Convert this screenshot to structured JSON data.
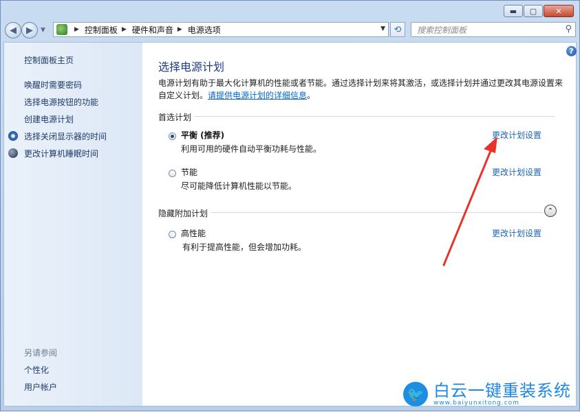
{
  "window": {
    "minimize_glyph": "▬",
    "maximize_glyph": "▢",
    "close_glyph": "✕"
  },
  "nav": {
    "back_icon": "◀",
    "forward_icon": "▶",
    "recent_icon": "▼",
    "breadcrumbs": [
      "控制面板",
      "硬件和声音",
      "电源选项"
    ],
    "crumb_separator": "▶",
    "refresh_glyph": "⟲",
    "search_placeholder": "搜索控制面板",
    "search_glyph": "⚲"
  },
  "sidebar": {
    "home": "控制面板主页",
    "items": [
      {
        "label": "唤醒时需要密码",
        "icon": null
      },
      {
        "label": "选择电源按钮的功能",
        "icon": null
      },
      {
        "label": "创建电源计划",
        "icon": null
      },
      {
        "label": "选择关闭显示器的时间",
        "icon": "clock-icon"
      },
      {
        "label": "更改计算机睡眠时间",
        "icon": "moon-icon"
      }
    ],
    "see_also": "另请参阅",
    "see_also_items": [
      "个性化",
      "用户帐户"
    ]
  },
  "main": {
    "help_glyph": "?",
    "title": "选择电源计划",
    "description": "电源计划有助于最大化计算机的性能或者节能。通过选择计划来将其激活，或选择计划并通过更改其电源设置来自定义计划。",
    "description_link": "请提供电源计划的详细信息",
    "description_end": "。",
    "preferred_group": "首选计划",
    "hidden_group": "隐藏附加计划",
    "collapse_glyph": "⌃",
    "plans": [
      {
        "name": "平衡 (推荐)",
        "desc": "利用可用的硬件自动平衡功耗与性能。",
        "selected": true,
        "link": "更改计划设置"
      },
      {
        "name": "节能",
        "desc": "尽可能降低计算机性能以节能。",
        "selected": false,
        "link": "更改计划设置"
      },
      {
        "name": "高性能",
        "desc": "有利于提高性能，但会增加功耗。",
        "selected": false,
        "link": "更改计划设置"
      }
    ]
  },
  "watermark": {
    "title": "白云一键重装系统",
    "url": "www.baiyunxitong.com",
    "bird_glyph": "🐦",
    "color": "#1e88e5"
  },
  "annotation_arrow_color": "#e8322a"
}
